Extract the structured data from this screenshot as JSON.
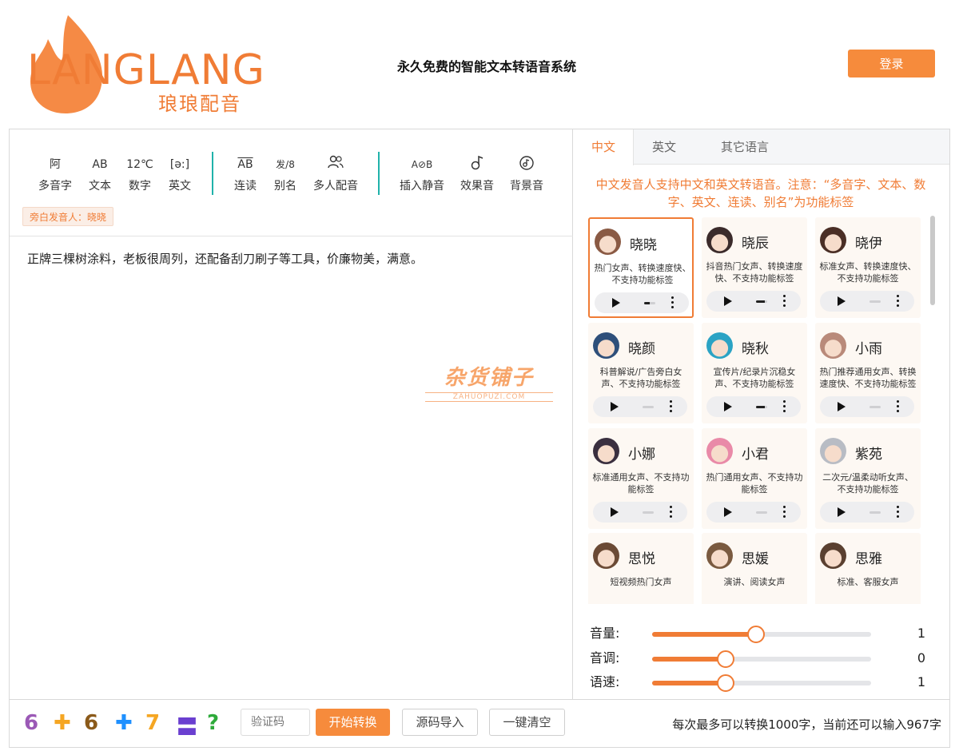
{
  "header": {
    "logo_text": "LANGLANG",
    "logo_sub": "琅琅配音",
    "site_title": "永久免费的智能文本转语音系统",
    "login_label": "登录"
  },
  "toolbar": {
    "groups": [
      [
        {
          "icon": "阿",
          "label": "多音字"
        },
        {
          "icon": "AB",
          "label": "文本"
        },
        {
          "icon": "12℃",
          "label": "数字"
        },
        {
          "icon": "[ə:]",
          "label": "英文"
        }
      ],
      [
        {
          "icon": "AB",
          "label": "连读"
        },
        {
          "icon": "发/8",
          "label": "别名"
        },
        {
          "icon": "people-icon",
          "label": "多人配音"
        }
      ],
      [
        {
          "icon": "A⊘B",
          "label": "插入静音"
        },
        {
          "icon": "sound-effect-icon",
          "label": "效果音"
        },
        {
          "icon": "music-icon",
          "label": "背景音"
        }
      ]
    ],
    "narrator": "旁白发音人：晓晓"
  },
  "editor": {
    "text": "正牌三棵树涂料，老板很周列，还配备刮刀刷子等工具，价廉物美，满意。"
  },
  "watermark": {
    "main": "杂货铺子",
    "sub": "ZAHUOPUZI.COM"
  },
  "voice_panel": {
    "tabs": [
      "中文",
      "英文",
      "其它语言"
    ],
    "active_tab": 0,
    "notice": "中文发音人支持中文和英文转语音。注意：“多音字、文本、数字、英文、连读、别名”为功能标签",
    "voices": [
      {
        "name": "晓晓",
        "desc": "热门女声、转换速度快、不支持功能标签",
        "selected": true,
        "progress": 0.5,
        "avatar_color": "#8a5a44"
      },
      {
        "name": "晓辰",
        "desc": "抖音热门女声、转换速度快、不支持功能标签",
        "selected": false,
        "progress": 0.8,
        "avatar_color": "#3b2b2b"
      },
      {
        "name": "晓伊",
        "desc": "标准女声、转换速度快、不支持功能标签",
        "selected": false,
        "progress": 0,
        "avatar_color": "#4a2e25"
      },
      {
        "name": "晓颜",
        "desc": "科普解说/广告旁白女声、不支持功能标签",
        "selected": false,
        "progress": 0,
        "avatar_color": "#2e4f7a"
      },
      {
        "name": "晓秋",
        "desc": "宣传片/纪录片沉稳女声、不支持功能标签",
        "selected": false,
        "progress": 0.8,
        "avatar_color": "#2ba3c4"
      },
      {
        "name": "小雨",
        "desc": "热门推荐通用女声、转换速度快、不支持功能标签",
        "selected": false,
        "progress": 0,
        "avatar_color": "#b98a7a"
      },
      {
        "name": "小娜",
        "desc": "标准通用女声、不支持功能标签",
        "selected": false,
        "progress": 0,
        "avatar_color": "#3a2f3f"
      },
      {
        "name": "小君",
        "desc": "热门通用女声、不支持功能标签",
        "selected": false,
        "progress": 0,
        "avatar_color": "#e98aa8"
      },
      {
        "name": "紫苑",
        "desc": "二次元/温柔动听女声、不支持功能标签",
        "selected": false,
        "progress": 0,
        "avatar_color": "#b8bcc4"
      },
      {
        "name": "思悦",
        "desc": "短视频热门女声",
        "selected": false,
        "progress": null,
        "avatar_color": "#6b4a35"
      },
      {
        "name": "思媛",
        "desc": "演讲、阅读女声",
        "selected": false,
        "progress": null,
        "avatar_color": "#7a5a40"
      },
      {
        "name": "思雅",
        "desc": "标准、客服女声",
        "selected": false,
        "progress": null,
        "avatar_color": "#5a4030"
      }
    ],
    "sliders": [
      {
        "label": "音量:",
        "value": "1",
        "fill": 0.475
      },
      {
        "label": "音调:",
        "value": "0",
        "fill": 0.335
      },
      {
        "label": "语速:",
        "value": "1",
        "fill": 0.335
      }
    ]
  },
  "bottom": {
    "captcha_chars": [
      {
        "ch": "6",
        "color": "#9b59b6"
      },
      {
        "ch": "✚",
        "color": "#f5a623"
      },
      {
        "ch": "6",
        "color": "#8b5a1a"
      },
      {
        "ch": "✚",
        "color": "#1e90ff"
      },
      {
        "ch": "7",
        "color": "#f5a623"
      },
      {
        "ch": "〓",
        "color": "#6a3fd0"
      },
      {
        "ch": "?",
        "color": "#2eaa3a"
      }
    ],
    "captcha_placeholder": "验证码",
    "start_label": "开始转换",
    "import_label": "源码导入",
    "clear_label": "一键清空",
    "char_count": "每次最多可以转换1000字，当前还可以输入967字"
  }
}
